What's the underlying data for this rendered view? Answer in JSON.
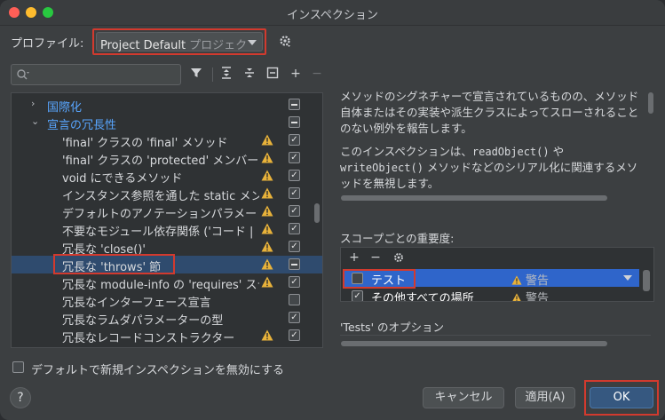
{
  "window": {
    "title": "インスペクション"
  },
  "profile": {
    "label": "プロファイル:",
    "value": "Project Default",
    "hint": "プロジェク"
  },
  "toolbar": {
    "filter": "▼",
    "expand": "⇅",
    "collapse": "⇳",
    "reset": "⊟",
    "add": "+",
    "remove": "−"
  },
  "tree": {
    "rows": [
      {
        "label": "国際化",
        "arrow": "›",
        "category": true,
        "warn": false,
        "check": "dash"
      },
      {
        "label": "宣言の冗長性",
        "arrow": "⌄",
        "category": true,
        "warn": false,
        "check": "dash"
      },
      {
        "label": "'final' クラスの 'final' メソッド",
        "warn": true,
        "check": "checked"
      },
      {
        "label": "'final' クラスの 'protected' メンバー",
        "warn": true,
        "check": "checked"
      },
      {
        "label": "void にできるメソッド",
        "warn": true,
        "check": "checked"
      },
      {
        "label": "インスタンス参照を通した static メン",
        "warn": true,
        "check": "checked"
      },
      {
        "label": "デフォルトのアノテーションパラメー",
        "warn": true,
        "check": "checked"
      },
      {
        "label": "不要なモジュール依存関係 ('コード | ",
        "warn": true,
        "check": "checked"
      },
      {
        "label": "冗長な 'close()'",
        "warn": true,
        "check": "checked"
      },
      {
        "label": "冗長な 'throws' 節",
        "warn": true,
        "check": "dash",
        "selected": true
      },
      {
        "label": "冗長な module-info の 'requires' ステ",
        "warn": true,
        "check": "checked"
      },
      {
        "label": "冗長なインターフェース宣言",
        "warn": false,
        "check": "unchecked"
      },
      {
        "label": "冗長なラムダパラメーターの型",
        "warn": false,
        "check": "checked"
      },
      {
        "label": "冗長なレコードコンストラクター",
        "warn": true,
        "check": "checked"
      }
    ]
  },
  "description": {
    "p1": "メソッドのシグネチャーで宣言されているものの、メソッド自体またはその実装や派生クラスによってスローされることのない例外を報告します。",
    "p2_pre": "このインスペクションは、",
    "p2_code1": "readObject()",
    "p2_mid": " や ",
    "p2_code2": "writeObject()",
    "p2_post": " メソッドなどのシリアル化に関連するメソッドを無視します。"
  },
  "scope": {
    "label": "スコープごとの重要度:",
    "rows": [
      {
        "name": "テスト",
        "level": "警告",
        "selected": true
      },
      {
        "name": "その他すべての場所",
        "level": "警告",
        "selected": false
      }
    ]
  },
  "options": {
    "label": "'Tests' のオプション"
  },
  "footer": {
    "disable_label": "デフォルトで新規インスペクションを無効にする",
    "help": "?",
    "cancel": "キャンセル",
    "apply": "適用(A)",
    "ok": "OK"
  },
  "colors": {
    "accent": "#2f65ca",
    "highlight": "#d23a2e",
    "warning": "#e8b23a",
    "category": "#58a6ff"
  }
}
